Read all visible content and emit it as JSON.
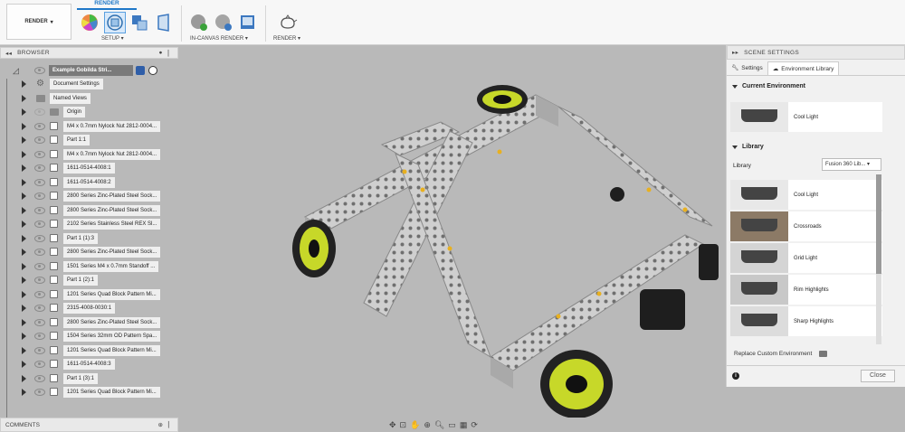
{
  "toolbar": {
    "workspace_label": "RENDER",
    "active_tab": "RENDER",
    "groups": [
      {
        "label": "SETUP ▾"
      },
      {
        "label": "IN-CANVAS RENDER ▾"
      },
      {
        "label": "RENDER ▾"
      }
    ]
  },
  "browser": {
    "title": "BROWSER",
    "root_label": "Example Gobilda Stri...",
    "items": [
      {
        "label": "Document Settings",
        "kind": "settings"
      },
      {
        "label": "Named Views",
        "kind": "folder"
      },
      {
        "label": "Origin",
        "kind": "folder"
      },
      {
        "label": "M4 x 0.7mm Nylock Nut 2812-0004...",
        "kind": "component"
      },
      {
        "label": "Part 1:1",
        "kind": "component"
      },
      {
        "label": "M4 x 0.7mm Nylock Nut 2812-0004...",
        "kind": "component"
      },
      {
        "label": "1611-0514-4008:1",
        "kind": "component"
      },
      {
        "label": "1611-0514-4008:2",
        "kind": "component"
      },
      {
        "label": "2800 Series Zinc-Plated Steel Sock...",
        "kind": "component"
      },
      {
        "label": "2800 Series Zinc-Plated Steel Sock...",
        "kind": "component"
      },
      {
        "label": "2102 Series Stainless Steel REX Sl...",
        "kind": "component"
      },
      {
        "label": "Part 1 (1):3",
        "kind": "component"
      },
      {
        "label": "2800 Series Zinc-Plated Steel Sock...",
        "kind": "component"
      },
      {
        "label": "1501 Series M4 x 0.7mm Standoff ...",
        "kind": "component"
      },
      {
        "label": "Part 1 (2):1",
        "kind": "component"
      },
      {
        "label": "1201 Series Quad Block Pattern Mi...",
        "kind": "component"
      },
      {
        "label": "2315-4008-0030:1",
        "kind": "component"
      },
      {
        "label": "2800 Series Zinc-Plated Steel Sock...",
        "kind": "component"
      },
      {
        "label": "1504 Series 32mm OD Pattern Spa...",
        "kind": "component"
      },
      {
        "label": "1201 Series Quad Block Pattern Mi...",
        "kind": "component"
      },
      {
        "label": "1611-0514-4008:3",
        "kind": "component"
      },
      {
        "label": "Part 1 (3):1",
        "kind": "component"
      },
      {
        "label": "1201 Series Quad Block Pattern Mi...",
        "kind": "component"
      }
    ]
  },
  "comments": {
    "title": "COMMENTS"
  },
  "scene_settings": {
    "title": "SCENE SETTINGS",
    "tabs": [
      {
        "label": "Settings",
        "icon": "wrench-icon"
      },
      {
        "label": "Environment Library",
        "icon": "cloud-icon"
      }
    ],
    "current_env_title": "Current Environment",
    "current_env": {
      "name": "Cool Light"
    },
    "library_title": "Library",
    "library_label": "Library",
    "library_value": "Fusion 360 Lib... ▾",
    "environments": [
      {
        "name": "Cool Light",
        "color": "#e8e8e8"
      },
      {
        "name": "Crossroads",
        "color": "#8c7a66"
      },
      {
        "name": "Grid Light",
        "color": "#d4d4d4"
      },
      {
        "name": "Rim Highlights",
        "color": "#c8c8c8"
      },
      {
        "name": "Sharp Highlights",
        "color": "#dcdcdc"
      }
    ],
    "replace_label": "Replace Custom Environment",
    "close_label": "Close"
  },
  "colors": {
    "accent": "#1f78c8",
    "part_yellow": "#d9ec2a",
    "viewport_bg": "#b9b9b9"
  }
}
